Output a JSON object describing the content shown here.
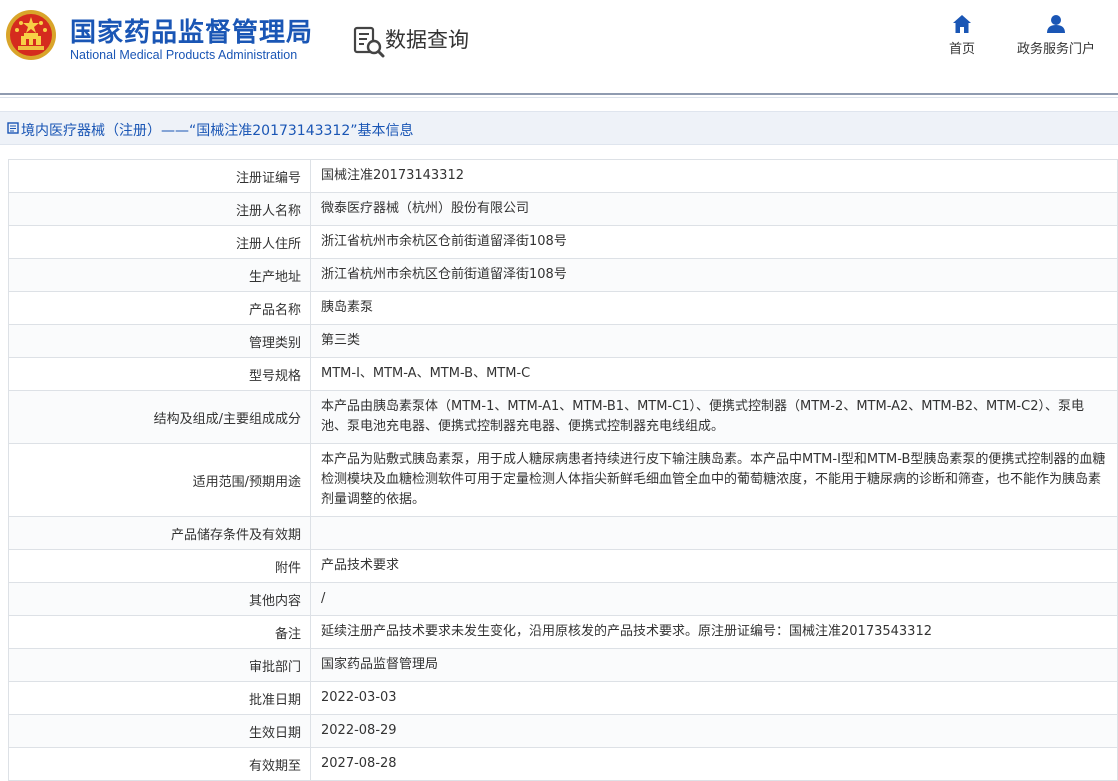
{
  "header": {
    "site_name_cn": "国家药品监督管理局",
    "site_name_en": "National Medical Products Administration",
    "section_title": "数据查询",
    "nav": [
      {
        "label": "首页",
        "icon": "home-icon"
      },
      {
        "label": "政务服务门户",
        "icon": "user-icon"
      }
    ]
  },
  "breadcrumb": {
    "text": "境内医疗器械（注册）——“国械注准20173143312”基本信息"
  },
  "colors": {
    "brand_blue": "#1a56b5",
    "breadcrumb_bg": "#eef2f8",
    "border": "#dde1e6"
  },
  "details": [
    {
      "label": "注册证编号",
      "value": "国械注准20173143312"
    },
    {
      "label": "注册人名称",
      "value": "微泰医疗器械（杭州）股份有限公司"
    },
    {
      "label": "注册人住所",
      "value": "浙江省杭州市余杭区仓前街道留泽街108号"
    },
    {
      "label": "生产地址",
      "value": "浙江省杭州市余杭区仓前街道留泽街108号"
    },
    {
      "label": "产品名称",
      "value": "胰岛素泵"
    },
    {
      "label": "管理类别",
      "value": "第三类"
    },
    {
      "label": "型号规格",
      "value": "MTM-I、MTM-A、MTM-B、MTM-C"
    },
    {
      "label": "结构及组成/主要组成成分",
      "value": "本产品由胰岛素泵体（MTM-1、MTM-A1、MTM-B1、MTM-C1）、便携式控制器（MTM-2、MTM-A2、MTM-B2、MTM-C2）、泵电池、泵电池充电器、便携式控制器充电器、便携式控制器充电线组成。"
    },
    {
      "label": "适用范围/预期用途",
      "value": "本产品为贴敷式胰岛素泵，用于成人糖尿病患者持续进行皮下输注胰岛素。本产品中MTM-I型和MTM-B型胰岛素泵的便携式控制器的血糖检测模块及血糖检测软件可用于定量检测人体指尖新鲜毛细血管全血中的葡萄糖浓度，不能用于糖尿病的诊断和筛查，也不能作为胰岛素剂量调整的依据。"
    },
    {
      "label": "产品储存条件及有效期",
      "value": ""
    },
    {
      "label": "附件",
      "value": "产品技术要求"
    },
    {
      "label": "其他内容",
      "value": "/"
    },
    {
      "label": "备注",
      "value": "延续注册产品技术要求未发生变化，沿用原核发的产品技术要求。原注册证编号：国械注准20173543312"
    },
    {
      "label": "审批部门",
      "value": "国家药品监督管理局"
    },
    {
      "label": "批准日期",
      "value": "2022-03-03"
    },
    {
      "label": "生效日期",
      "value": "2022-08-29"
    },
    {
      "label": "有效期至",
      "value": "2027-08-28"
    }
  ]
}
